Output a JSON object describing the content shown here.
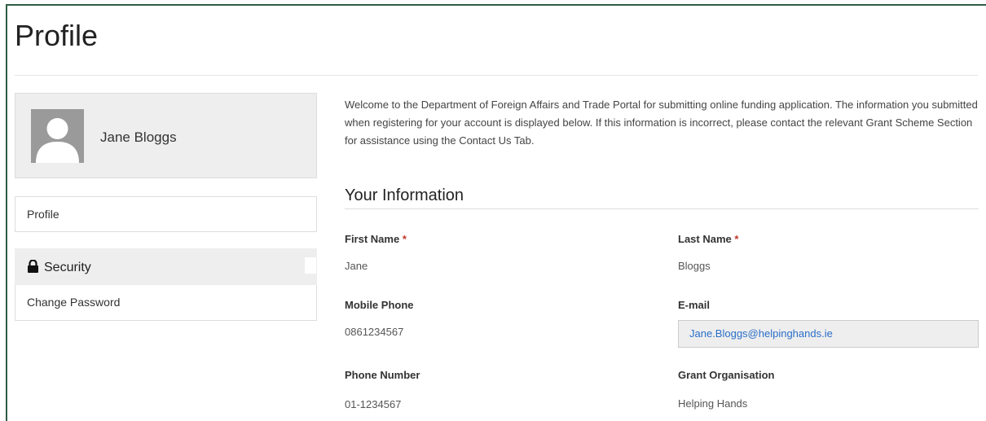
{
  "page": {
    "title": "Profile"
  },
  "sidebar": {
    "user_name": "Jane Bloggs",
    "profile_link": "Profile",
    "security_header": "Security",
    "change_password_link": "Change Password"
  },
  "main": {
    "intro_text": "Welcome to the Department of Foreign Affairs and Trade Portal for submitting online funding application. The information you submitted when registering for your account is displayed below. If this information is incorrect, please contact the relevant Grant Scheme Section for assistance using the Contact Us Tab.",
    "section_title": "Your Information",
    "required_marker": "*",
    "fields": {
      "first_name": {
        "label": "First Name",
        "value": "Jane"
      },
      "last_name": {
        "label": "Last Name",
        "value": "Bloggs"
      },
      "mobile_phone": {
        "label": "Mobile Phone",
        "value": "0861234567"
      },
      "email": {
        "label": "E-mail",
        "value": "Jane.Bloggs@helpinghands.ie"
      },
      "phone_number": {
        "label": "Phone Number",
        "value": "01-1234567"
      },
      "grant_organisation": {
        "label": "Grant Organisation",
        "value": "Helping Hands"
      }
    }
  },
  "colors": {
    "frame_border": "#2e5d45",
    "panel_bg": "#eeeeee",
    "required": "#c0392b",
    "email_link": "#2a6fc9"
  },
  "icons": {
    "avatar": "user-silhouette-icon",
    "security": "lock-icon"
  }
}
